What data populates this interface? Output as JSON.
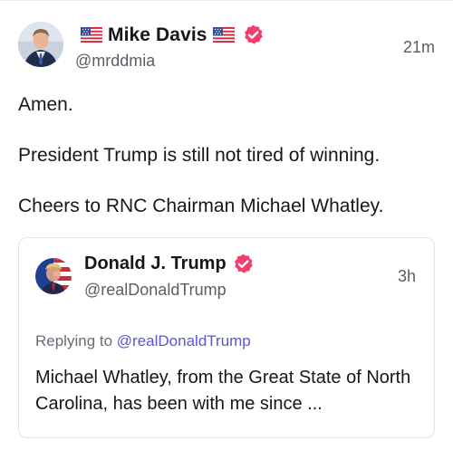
{
  "post": {
    "author": {
      "display_name": "Mike Davis",
      "handle": "@mrddmia",
      "verified": true,
      "flag_left": "us-flag-icon",
      "flag_right": "us-flag-icon"
    },
    "timestamp": "21m",
    "paragraphs": [
      "Amen.",
      "President Trump is still not tired of winning.",
      "Cheers to RNC Chairman Michael Whatley."
    ],
    "quoted": {
      "author": {
        "display_name": "Donald J. Trump",
        "handle": "@realDonaldTrump",
        "verified": true
      },
      "timestamp": "3h",
      "replying_to_prefix": "Replying to",
      "replying_to_handle": "@realDonaldTrump",
      "text": "Michael Whatley, from the Great State of North Carolina, has been with me since ..."
    }
  },
  "colors": {
    "verified_badge": "#f33d6b",
    "mention": "#5b55d6",
    "secondary_text": "#5c5c66"
  }
}
